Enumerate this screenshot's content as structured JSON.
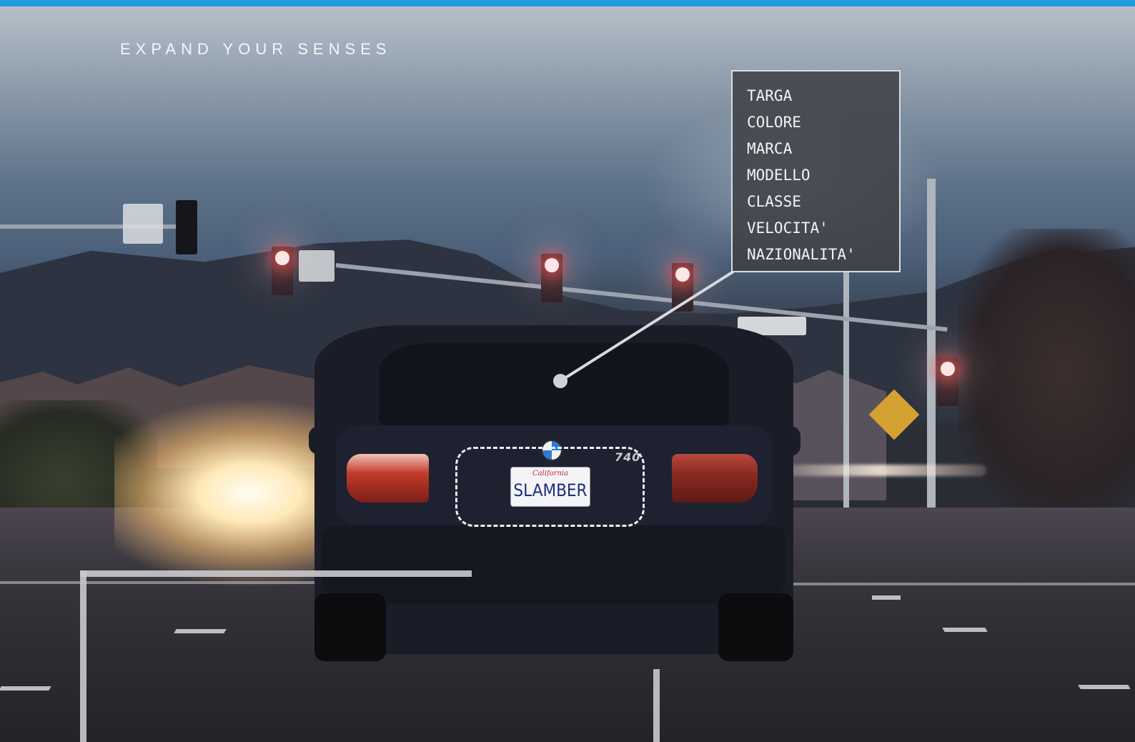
{
  "hero": {
    "headline": "EXPAND YOUR SENSES"
  },
  "detection_panel": {
    "attributes": [
      "TARGA",
      "COLORE",
      "MARCA",
      "MODELLO",
      "CLASSE",
      "VELOCITA'",
      "NAZIONALITA'"
    ]
  },
  "scene": {
    "plate_state": "California",
    "plate_text": "SLAMBER",
    "model_badge": "740"
  },
  "colors": {
    "accent_bar": "#1e9be0",
    "panel_bg": "#3e4046",
    "overlay_line": "#d9dde2"
  },
  "icons": [
    "bmw-logo-icon"
  ]
}
